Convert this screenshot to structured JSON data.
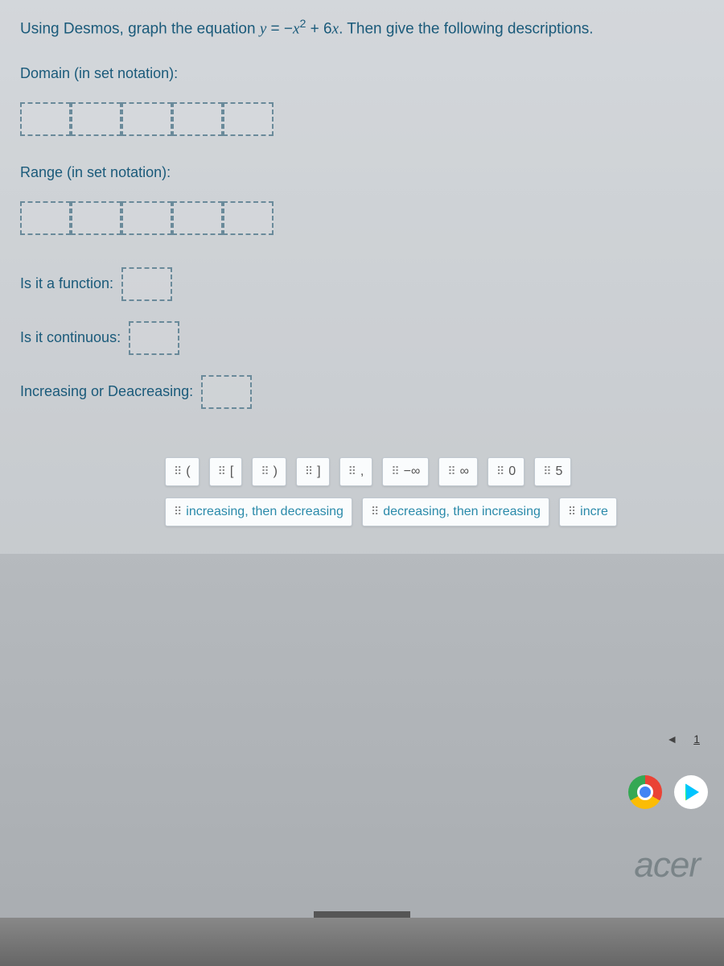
{
  "question": {
    "prefix": "Using Desmos, graph the equation ",
    "equation_html": "y = −x² + 6x",
    "suffix": ". Then give the following descriptions."
  },
  "fields": {
    "domain_label": "Domain (in set notation):",
    "range_label": "Range (in set notation):",
    "function_label": "Is it a function:",
    "continuous_label": "Is it continuous:",
    "increasing_label": "Increasing or Deacreasing:"
  },
  "tiles": {
    "row1": [
      "(",
      "[",
      ")",
      "]",
      ",",
      "−∞",
      "∞",
      "0",
      "5"
    ],
    "row2": [
      "increasing, then decreasing",
      "decreasing, then increasing",
      "incre"
    ]
  },
  "nav": {
    "page": "1"
  },
  "brand": "acer"
}
